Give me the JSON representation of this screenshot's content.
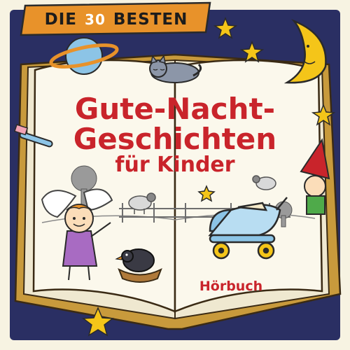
{
  "banner": {
    "prefix": "DIE",
    "number": "30",
    "suffix": "BESTEN"
  },
  "title": {
    "line1": "Gute-Nacht-",
    "line2": "Geschichten",
    "line3": "für Kinder"
  },
  "badge": "Hörbuch",
  "colors": {
    "night_sky": "#2A2F63",
    "banner": "#E8922A",
    "title_red": "#C9242B",
    "page_cream": "#FBF8EC",
    "book_cover": "#C89A3C",
    "star_yellow": "#F4C519",
    "stroller_blue": "#8CC4E6"
  }
}
